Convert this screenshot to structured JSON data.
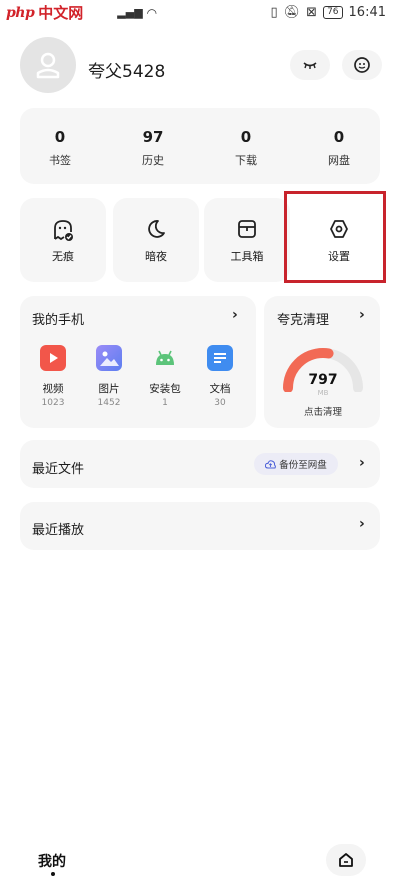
{
  "status_bar": {
    "logo_php": "php",
    "logo_cn": "中文网",
    "battery": "76",
    "time": "16:41"
  },
  "profile": {
    "username": "夸父5428"
  },
  "stats": [
    {
      "value": "0",
      "label": "书签"
    },
    {
      "value": "97",
      "label": "历史"
    },
    {
      "value": "0",
      "label": "下载"
    },
    {
      "value": "0",
      "label": "网盘"
    }
  ],
  "tools": [
    {
      "label": "无痕",
      "icon": "ghost-icon"
    },
    {
      "label": "暗夜",
      "icon": "moon-icon"
    },
    {
      "label": "工具箱",
      "icon": "toolbox-icon"
    },
    {
      "label": "设置",
      "icon": "hexagon-gear-icon"
    }
  ],
  "my_phone": {
    "title": "我的手机",
    "apps": [
      {
        "name": "视频",
        "count": "1023",
        "color": "#f2564a"
      },
      {
        "name": "图片",
        "count": "1452",
        "color": "#7b6ff0"
      },
      {
        "name": "安装包",
        "count": "1",
        "color": "#5cc47a"
      },
      {
        "name": "文档",
        "count": "30",
        "color": "#3f8cf0"
      }
    ]
  },
  "cleaner": {
    "title": "夸克清理",
    "value": "797",
    "unit": "MB",
    "action": "点击清理",
    "gauge_fraction": 0.55,
    "gauge_color": "#f26a55"
  },
  "recent_files": {
    "title": "最近文件",
    "backup_label": "备份至网盘"
  },
  "recent_play": {
    "title": "最近播放"
  },
  "bottom_bar": {
    "tab_label": "我的"
  }
}
